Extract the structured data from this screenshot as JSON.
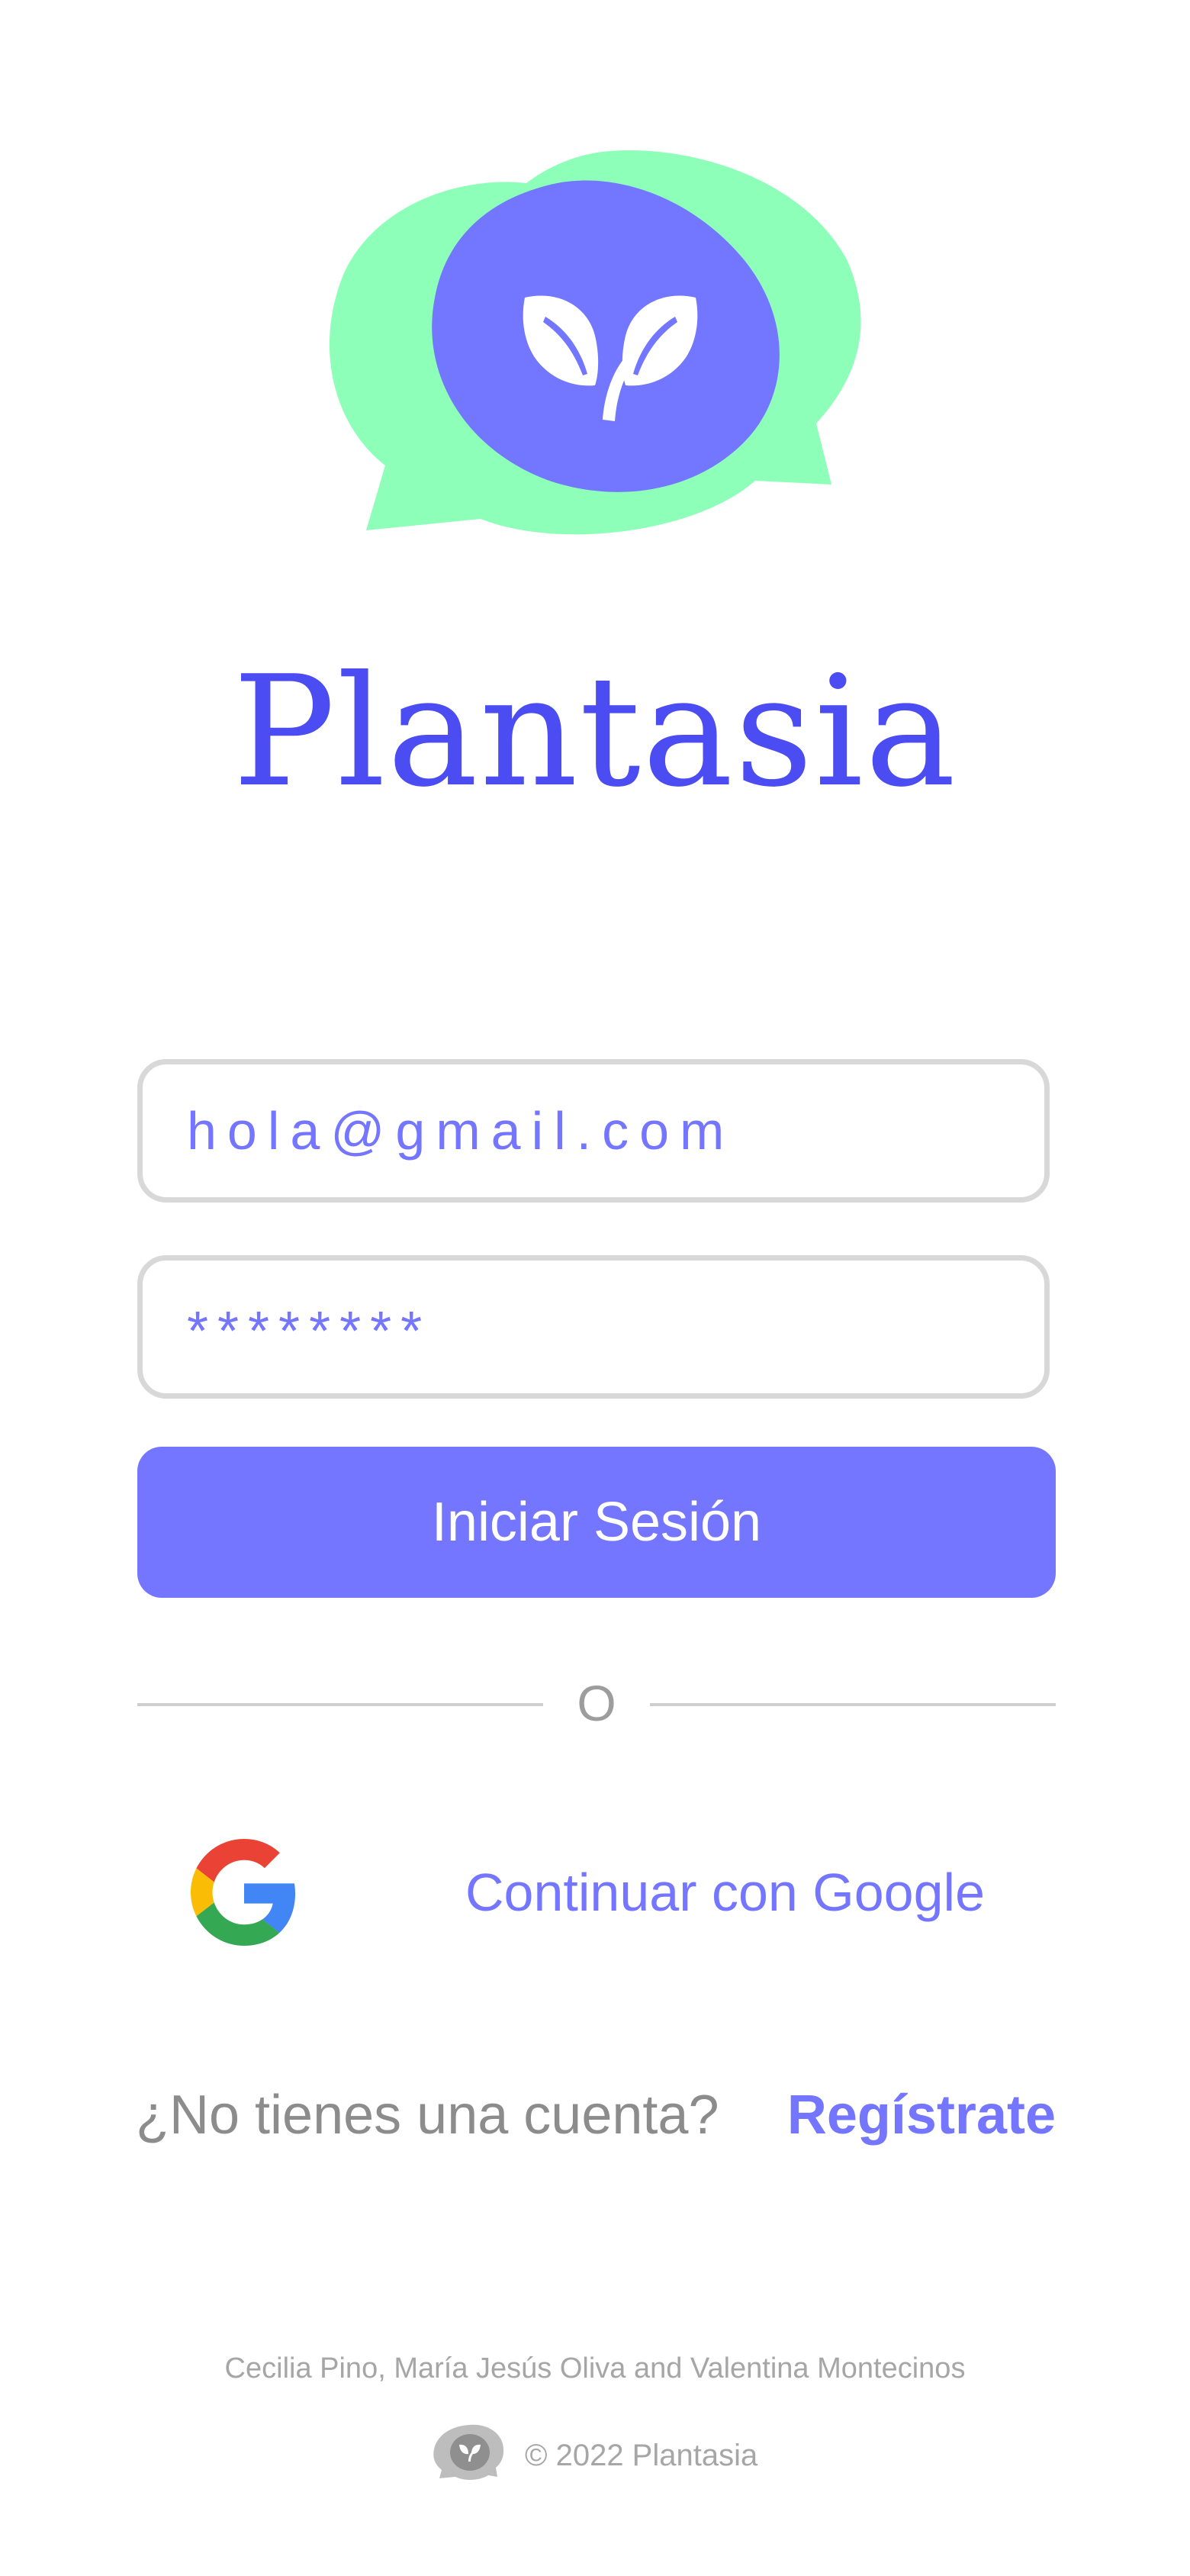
{
  "app": {
    "name": "Plantasia",
    "logo_icon": "plant-chat-bubbles-icon"
  },
  "colors": {
    "primary": "#7476FF",
    "brand_text": "#4B4CF1",
    "bubble_green": "#8EFFB9",
    "bubble_blue": "#7377FF",
    "border": "#D8D8D8",
    "muted_text": "#8C8C8C",
    "footer_text": "#A6A6A6"
  },
  "login": {
    "email_value": "hola@gmail.com",
    "password_value": "********",
    "submit_label": "Iniciar Sesión",
    "divider_text": "O",
    "google_label": "Continuar con Google",
    "google_icon": "google-g-icon"
  },
  "signup": {
    "question": "¿No tienes una cuenta?",
    "link_label": "Regístrate"
  },
  "footer": {
    "credits": "Cecilia Pino, María Jesús Oliva and Valentina Montecinos",
    "copyright": "© 2022 Plantasia"
  }
}
